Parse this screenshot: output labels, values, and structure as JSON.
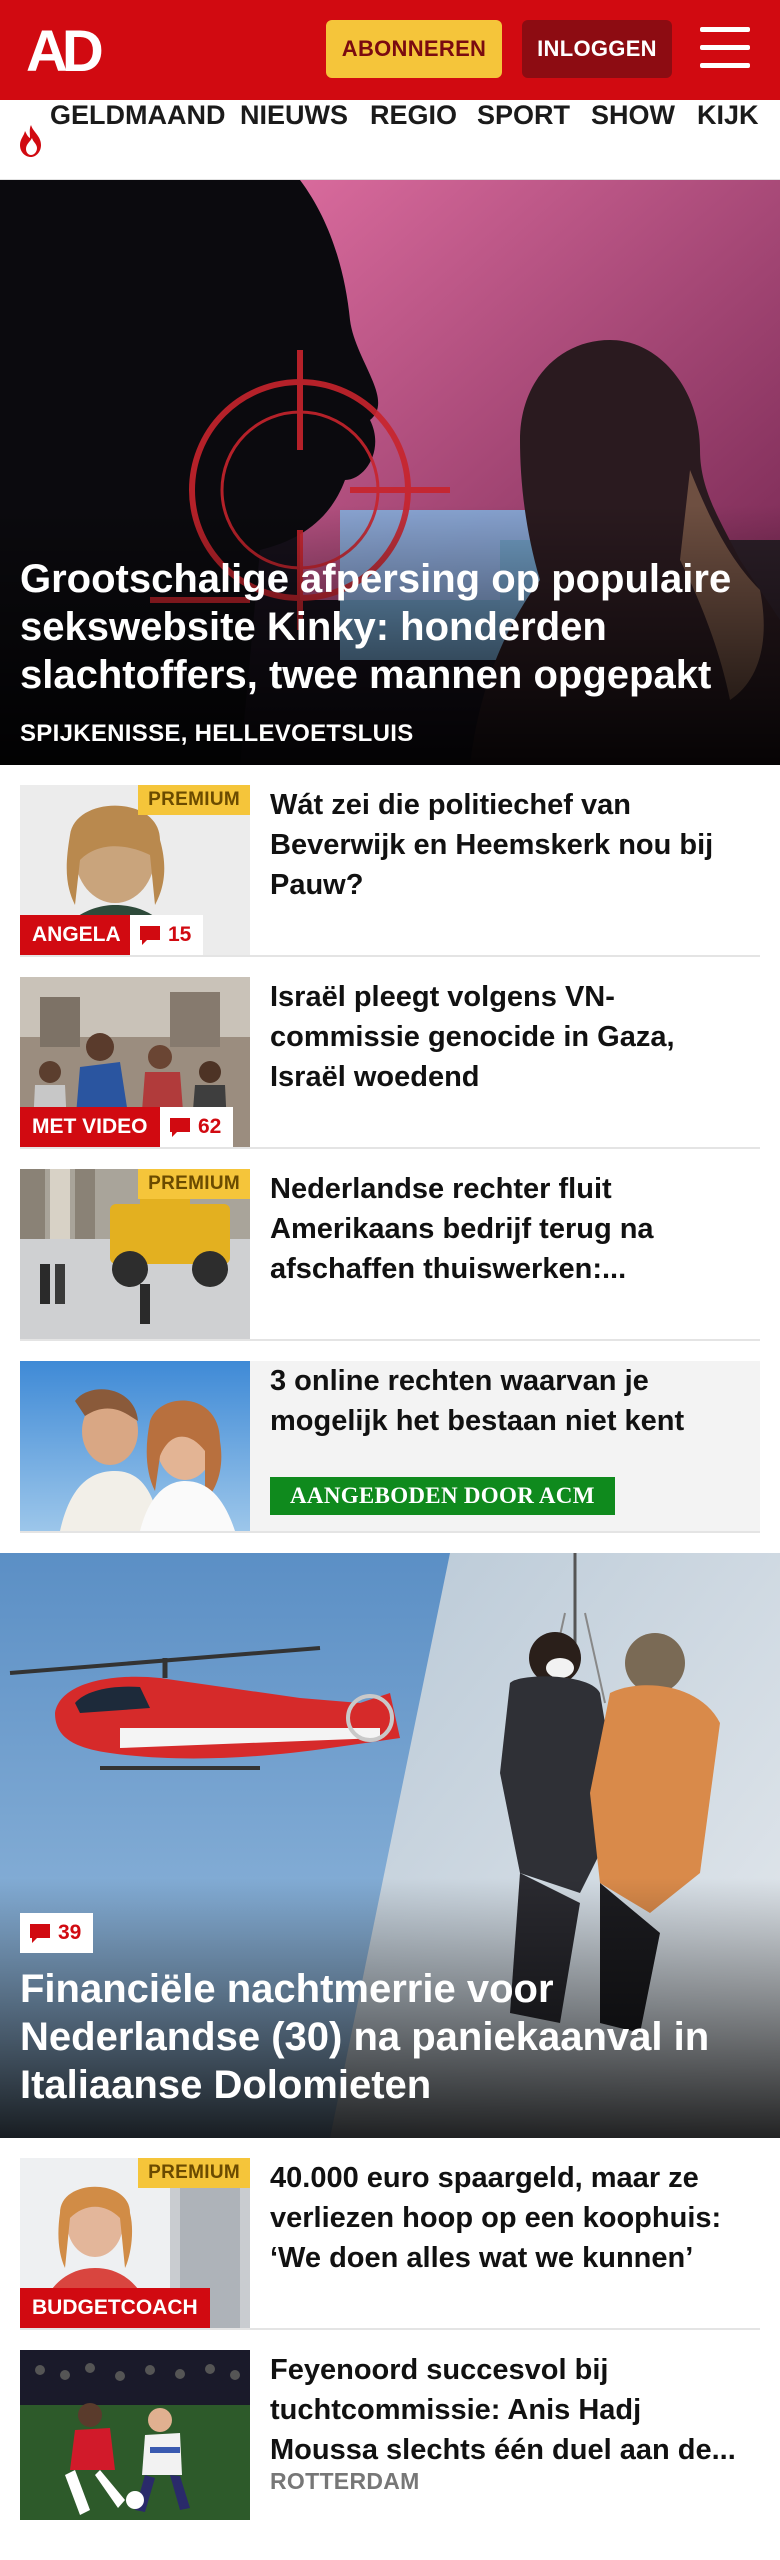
{
  "header": {
    "logo_text": "AD",
    "subscribe_label": "ABONNEREN",
    "login_label": "INLOGGEN",
    "brand_color": "#d10a11"
  },
  "nav": {
    "items": [
      "GELDMAAND",
      "NIEUWS",
      "REGIO",
      "SPORT",
      "SHOW",
      "KIJK"
    ],
    "flame_icon": "flame-icon"
  },
  "hero_top": {
    "title": "Grootschalige afpersing op populaire sekswebsite Kinky: honderden slachtoffers, twee mannen opgepakt",
    "location": "SPIJKENISSE, HELLEVOETSLUIS"
  },
  "articles": [
    {
      "title": "Wát zei die politiechef van Beverwijk en Heemskerk nou bij Pauw?",
      "premium": "PREMIUM",
      "label": "ANGELA",
      "comments": "15"
    },
    {
      "title": "Israël pleegt volgens VN-commissie genocide in Gaza, Israël woedend",
      "label": "MET VIDEO",
      "comments": "62"
    },
    {
      "title": "Nederlandse rechter fluit Amerikaans bedrijf terug na afschaffen thuiswerken:...",
      "premium": "PREMIUM"
    },
    {
      "title": "3 online rechten waarvan je mogelijk het bestaan niet kent",
      "sponsor_label": "AANGEBODEN DOOR ACM"
    }
  ],
  "hero_bottom": {
    "title": "Financiële nachtmerrie voor Nederlandse (30) na paniekaanval in Italiaanse Dolomieten",
    "comments": "39"
  },
  "articles2": [
    {
      "title": "40.000 euro spaargeld, maar ze verliezen hoop op een koophuis: ‘We doen alles wat we kunnen’",
      "premium": "PREMIUM",
      "label": "BUDGETCOACH"
    },
    {
      "title": "Feyenoord succesvol bij tuchtcommissie: Anis Hadj Moussa slechts één duel aan de...",
      "location": "ROTTERDAM"
    }
  ]
}
